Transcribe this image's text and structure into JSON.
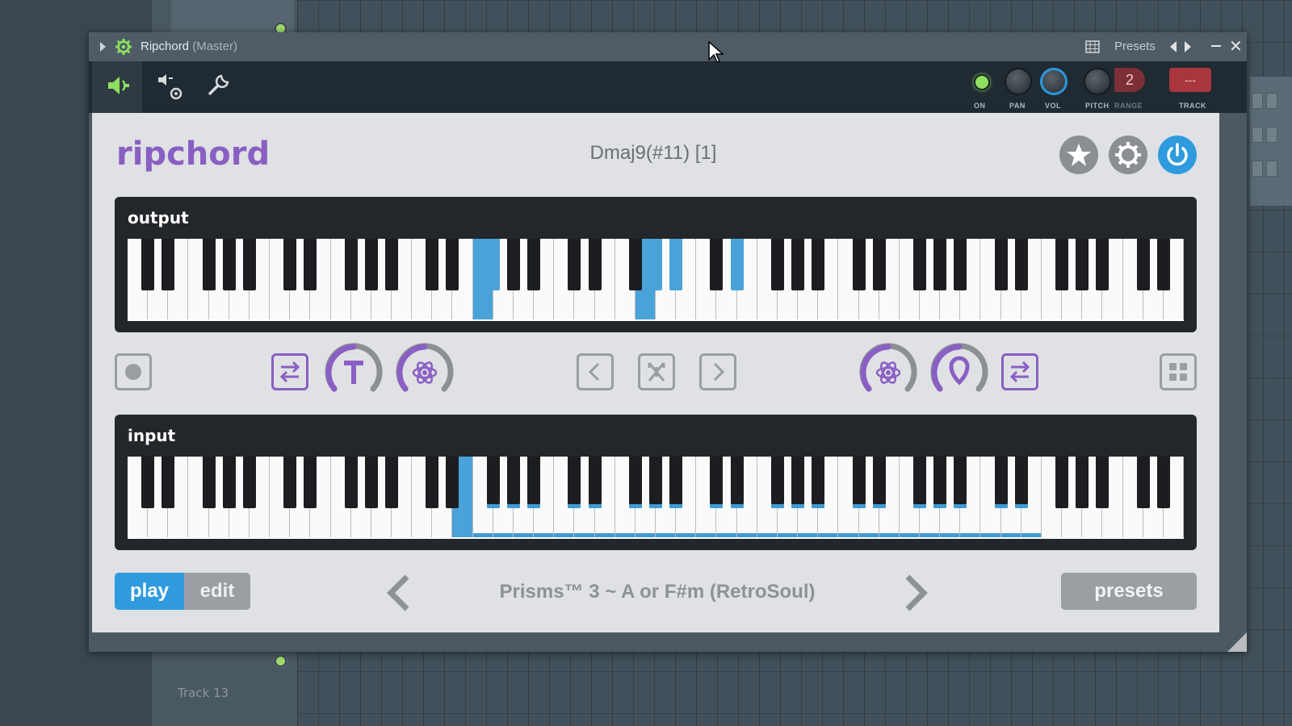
{
  "background": {
    "track_label": "Track 13"
  },
  "window": {
    "title": "Ripchord",
    "title_suffix": "(Master)",
    "presets_label": "Presets",
    "close_glyph": "✕"
  },
  "toolbar": {
    "on_label": "ON",
    "pan_label": "PAN",
    "vol_label": "VOL",
    "pitch_label": "PITCH",
    "range_label": "RANGE",
    "range_value": "2",
    "track_label": "TRACK",
    "track_value": "---"
  },
  "plugin": {
    "brand": "ripchord",
    "chord_name": "Dmaj9(#11) [1]",
    "output_label": "output",
    "input_label": "input",
    "play_label": "play",
    "edit_label": "edit",
    "mode": "play",
    "preset_name": "Prisms™ 3 ~ A or F#m (RetroSoul)",
    "presets_button": "presets",
    "accent_color": "#8a5fc4",
    "active_color": "#2f9bde"
  },
  "keyboard": {
    "white_key_count": 52,
    "output_active_white": [
      17,
      25
    ],
    "output_active_black": [
      12,
      18,
      19,
      21
    ],
    "input_active_white": [
      16
    ],
    "input_mapped_range": [
      16,
      44
    ]
  },
  "icons": {
    "toolbar": [
      "plugin-speaker-icon",
      "speaker-settings-icon",
      "wrench-icon"
    ],
    "header": [
      "star-icon",
      "settings-icon",
      "power-icon"
    ],
    "controls": [
      "record-icon",
      "shift-left-icon",
      "transpose-dial-icon",
      "spread-dial-icon",
      "prev-chord-icon",
      "shuffle-icon",
      "next-chord-icon",
      "spread-right-dial-icon",
      "voicing-dial-icon",
      "shift-right-icon",
      "grid-icon"
    ]
  }
}
